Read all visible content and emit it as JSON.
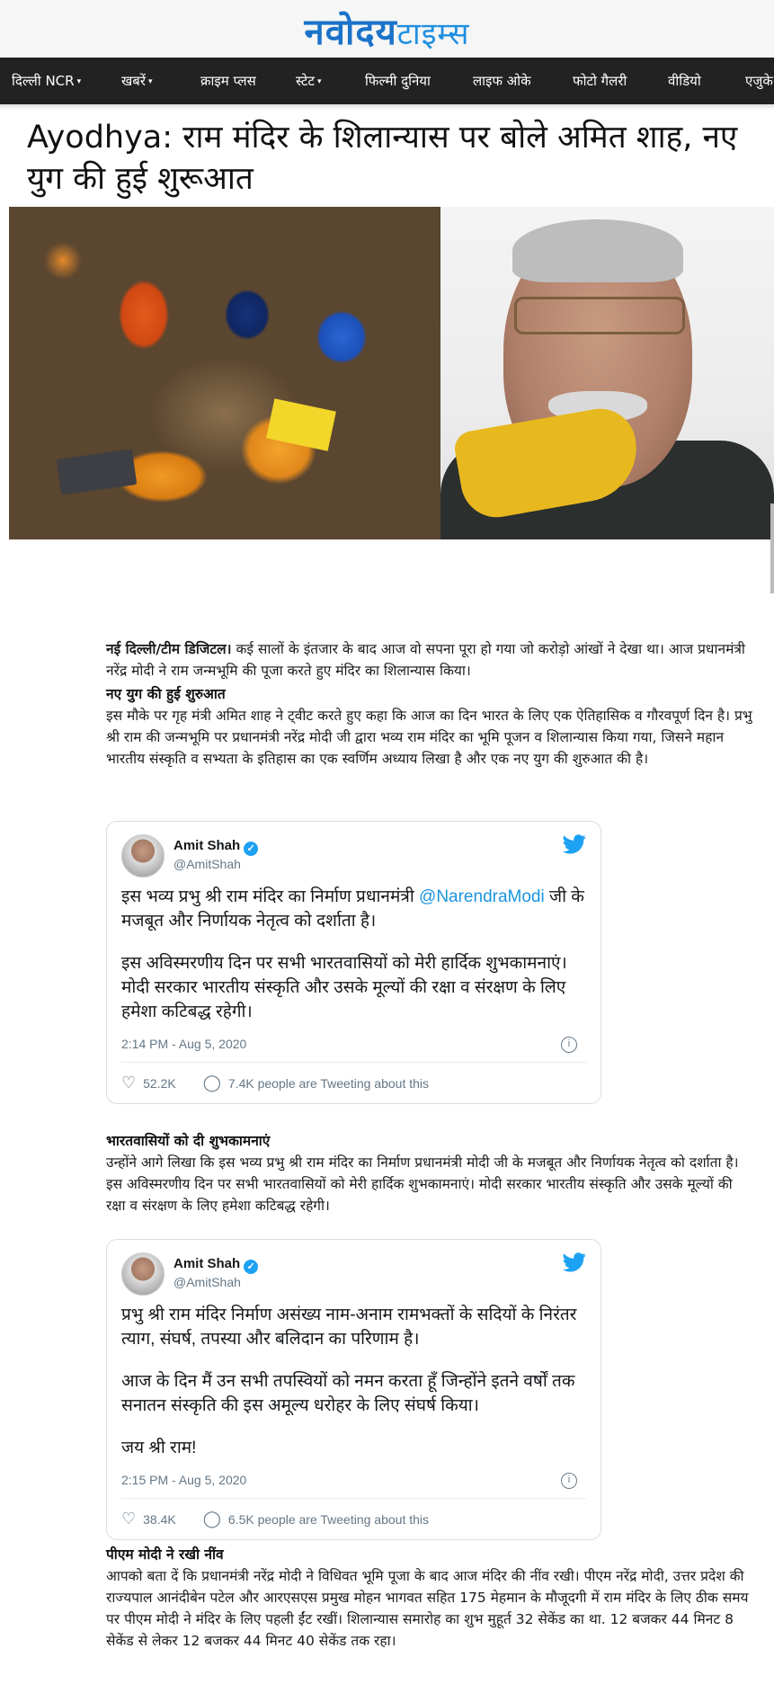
{
  "site": {
    "logo_part1": "नवोदय",
    "logo_part2": "टाइम्स"
  },
  "nav": {
    "items": [
      {
        "label": "दिल्ली NCR",
        "dropdown": true
      },
      {
        "label": "खबरें",
        "dropdown": true
      },
      {
        "label": "क्राइम प्लस",
        "dropdown": false
      },
      {
        "label": "स्टेट",
        "dropdown": true
      },
      {
        "label": "फिल्मी दुनिया",
        "dropdown": false
      },
      {
        "label": "लाइफ ओके",
        "dropdown": false
      },
      {
        "label": "फोटो गैलरी",
        "dropdown": false
      },
      {
        "label": "वीडियो",
        "dropdown": false
      },
      {
        "label": "एजुके",
        "dropdown": false
      }
    ]
  },
  "article": {
    "headline": "Ayodhya: राम मंदिर के शिलान्यास पर बोले अमित शाह, नए युग की हुई शुरूआत",
    "intro_lead": "नई दिल्ली/टीम डिजिटल।",
    "intro_text": " कई सालों के इंतजार के बाद आज वो सपना पूरा हो गया जो करोड़ो आंखों ने देखा था। आज प्रधानमंत्री नरेंद्र मोदी ने राम जन्मभूमि की पूजा करते हुए मंदिर का शिलान्यास किया।",
    "sub1": "नए युग की हुई शुरुआत",
    "para1": "इस मौके पर गृह मंत्री अमित शाह ने ट्वीट करते हुए कहा कि आज का दिन भारत के लिए एक ऐतिहासिक व गौरवपूर्ण दिन है। प्रभु श्री राम की जन्मभूमि पर प्रधानमंत्री नरेंद्र मोदी जी द्वारा भव्य राम मंदिर का भूमि पूजन व शिलान्यास किया गया, जिसने महान भारतीय संस्कृति व सभ्यता के इतिहास का एक स्वर्णिम अध्याय लिखा है और एक नए युग की शुरुआत की है।",
    "sub2": "भारतवासियों को दी शुभकामनाएं",
    "para2": "उन्होंने आगे लिखा कि इस भव्य प्रभु श्री राम मंदिर का निर्माण प्रधानमंत्री मोदी जी के मजबूत और निर्णायक नेतृत्व को दर्शाता है।इस अविस्मरणीय दिन पर सभी भारतवासियों को मेरी हार्दिक शुभकामनाएं। मोदी सरकार भारतीय संस्कृति और उसके मूल्यों की रक्षा व संरक्षण के लिए हमेशा कटिबद्ध रहेगी।",
    "sub3": "पीएम मोदी ने रखी नींव",
    "para3": "आपको बता दें कि  प्रधानमंत्री नरेंद्र मोदी ने विधिवत भूमि पूजा के बाद आज मंदिर की नींव रखी। पीएम नरेंद्र मोदी, उत्तर प्रदेश की राज्यपाल आनंदीबेन पटेल और आरएसएस प्रमुख मोहन भागवत सहित 175 मेहमान के मौजूदगी में राम मंदिर के लिए ठीक समय पर पीएम मोदी ने मंदिर के लिए पहली ईंट रखीं। शिलान्यास समारोह का शुभ मुहूर्त 32 सेकेंड का था. 12 बजकर 44 मिनट 8 सेकेंड से लेकर 12 बजकर 44 मिनट 40 सेकेंड तक रहा।"
  },
  "tweets": [
    {
      "name": "Amit Shah",
      "handle": "@AmitShah",
      "line1_pre": "इस भव्य प्रभु श्री राम मंदिर का निर्माण प्रधानमंत्री ",
      "line1_mention": "@NarendraModi",
      "line1_post": " जी के मजबूत और निर्णायक नेतृत्व को दर्शाता है।",
      "line2": "इस अविस्मरणीय दिन पर सभी भारतवासियों को मेरी हार्दिक शुभकामनाएं। मोदी सरकार भारतीय संस्कृति और उसके मूल्यों की रक्षा व संरक्षण के लिए हमेशा कटिबद्ध रहेगी।",
      "timestamp": "2:14 PM - Aug 5, 2020",
      "likes": "52.2K",
      "tweeting": "7.4K people are Tweeting about this"
    },
    {
      "name": "Amit Shah",
      "handle": "@AmitShah",
      "line1": "प्रभु श्री राम मंदिर निर्माण असंख्य नाम-अनाम रामभक्तों के सदियों के निरंतर त्याग, संघर्ष, तपस्या और बलिदान का परिणाम है।",
      "line2": "आज के दिन मैं उन सभी तपस्वियों को नमन करता हूँ जिन्होंने इतने वर्षों तक सनातन संस्कृति की इस अमूल्य धरोहर के लिए संघर्ष किया।",
      "line3": "जय श्री राम!",
      "timestamp": "2:15 PM - Aug 5, 2020",
      "likes": "38.4K",
      "tweeting": "6.5K people are Tweeting about this"
    }
  ],
  "icons": {
    "caret": "▾",
    "heart": "♡",
    "comment": "◯",
    "info": "i",
    "verified": "✓"
  },
  "colors": {
    "nav_bg": "#222222",
    "logo_blue": "#1a73c9",
    "twitter_blue": "#1da1f2",
    "mention": "#1b95e0"
  }
}
